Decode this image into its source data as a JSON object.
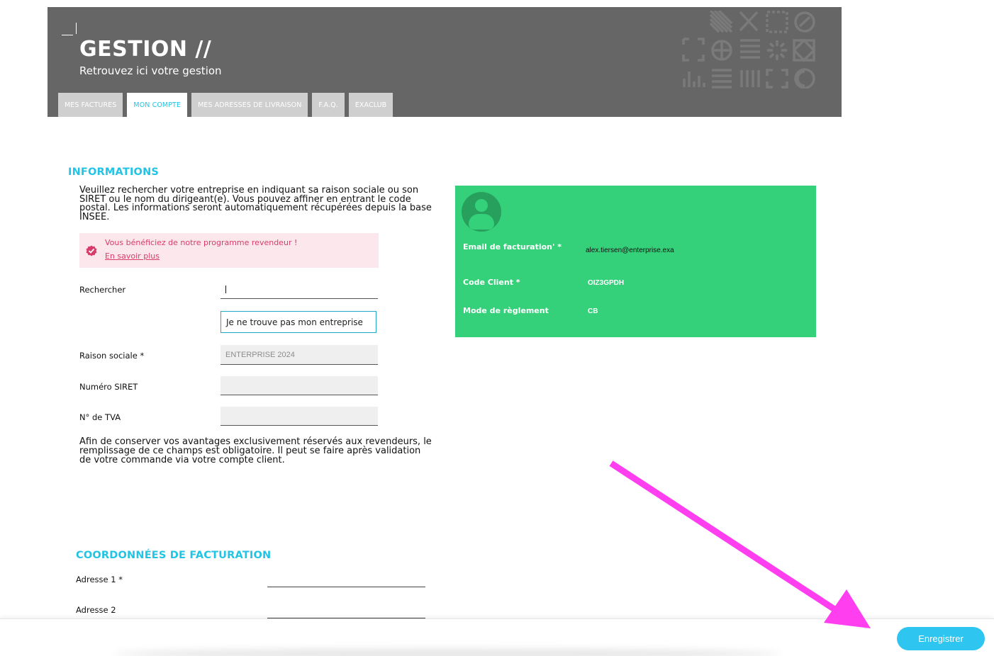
{
  "header": {
    "title": "GESTION //",
    "subtitle": "Retrouvez ici votre gestion",
    "tabs": [
      {
        "label": "MES FACTURES",
        "active": false
      },
      {
        "label": "MON COMPTE",
        "active": true
      },
      {
        "label": "MES ADRESSES DE LIVRAISON",
        "active": false
      },
      {
        "label": "F.A.Q.",
        "active": false
      },
      {
        "label": "EXACLUB",
        "active": false
      }
    ]
  },
  "informations": {
    "title": "INFORMATIONS",
    "intro": "Veuillez rechercher votre entreprise en indiquant sa raison sociale ou son SIRET ou le nom du dirigeant(e). Vous pouvez affiner en entrant le code postal. Les informations seront automatiquement récupérées depuis la base INSEE.",
    "reseller_msg": "Vous bénéficiez de notre programme revendeur !",
    "reseller_link": "En savoir plus",
    "search_label": "Rechercher",
    "search_value": "",
    "not_found_button": "Je ne trouve pas mon entreprise",
    "raison_label": "Raison sociale *",
    "raison_value": "ENTERPRISE 2024",
    "siret_label": "Numéro SIRET",
    "siret_value": "",
    "tva_label": "N° de TVA",
    "tva_value": "",
    "tva_note": "Afin de conserver vos avantages exclusivement réservés aux revendeurs, le remplissage de ce champs est obligatoire. Il peut se faire après validation de votre commande via votre compte client."
  },
  "account_card": {
    "email_label": "Email de facturation' *",
    "email_value": "alex.tiersen@enterprise.exa",
    "code_label": "Code Client *",
    "code_value": "OIZ3GPDH",
    "payment_label": "Mode de règlement",
    "payment_value": "CB"
  },
  "billing": {
    "title": "COORDONNÉES DE FACTURATION",
    "address1_label": "Adresse 1 *",
    "address2_label": "Adresse 2"
  },
  "footer": {
    "save_label": "Enregistrer"
  },
  "colors": {
    "accent": "#22c4e6",
    "header_bg": "#666666",
    "card_bg": "#34d17a",
    "reseller_bg": "#fce7ec",
    "reseller_text": "#d83c6a",
    "annotation_arrow": "#ff3ef0"
  }
}
